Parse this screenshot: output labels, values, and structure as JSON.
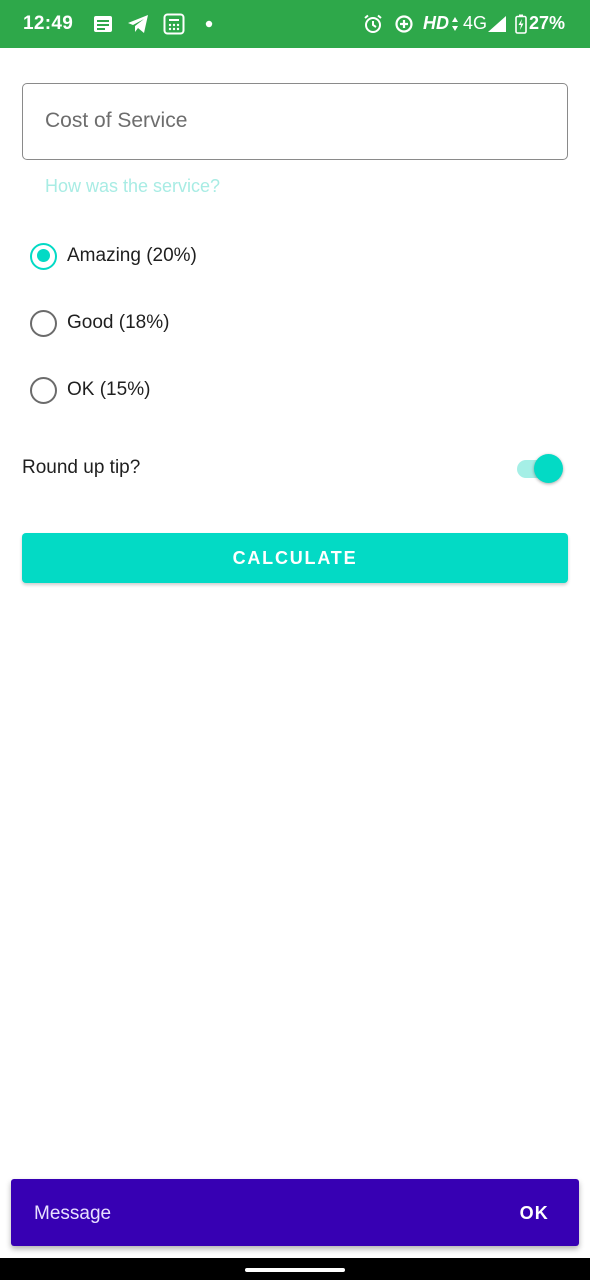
{
  "status_bar": {
    "time": "12:49",
    "hd": "HD",
    "network": "4G",
    "battery": "27%",
    "icons": [
      "message-icon",
      "telegram-icon",
      "calculator-icon",
      "notification-dot-icon",
      "alarm-icon",
      "data-saver-icon",
      "data-arrows-icon",
      "signal-icon",
      "battery-charging-icon"
    ]
  },
  "form": {
    "cost_placeholder": "Cost of Service",
    "service_question": "How was the service?",
    "options": [
      {
        "label": "Amazing (20%)",
        "checked": true
      },
      {
        "label": "Good (18%)",
        "checked": false
      },
      {
        "label": "OK (15%)",
        "checked": false
      }
    ],
    "round_up_label": "Round up tip?",
    "round_up_on": true,
    "calculate_label": "CALCULATE"
  },
  "snackbar": {
    "message": "Message",
    "action": "OK"
  },
  "colors": {
    "status_bar": "#2ea84a",
    "accent": "#03dac5",
    "snackbar": "#3700b3"
  }
}
